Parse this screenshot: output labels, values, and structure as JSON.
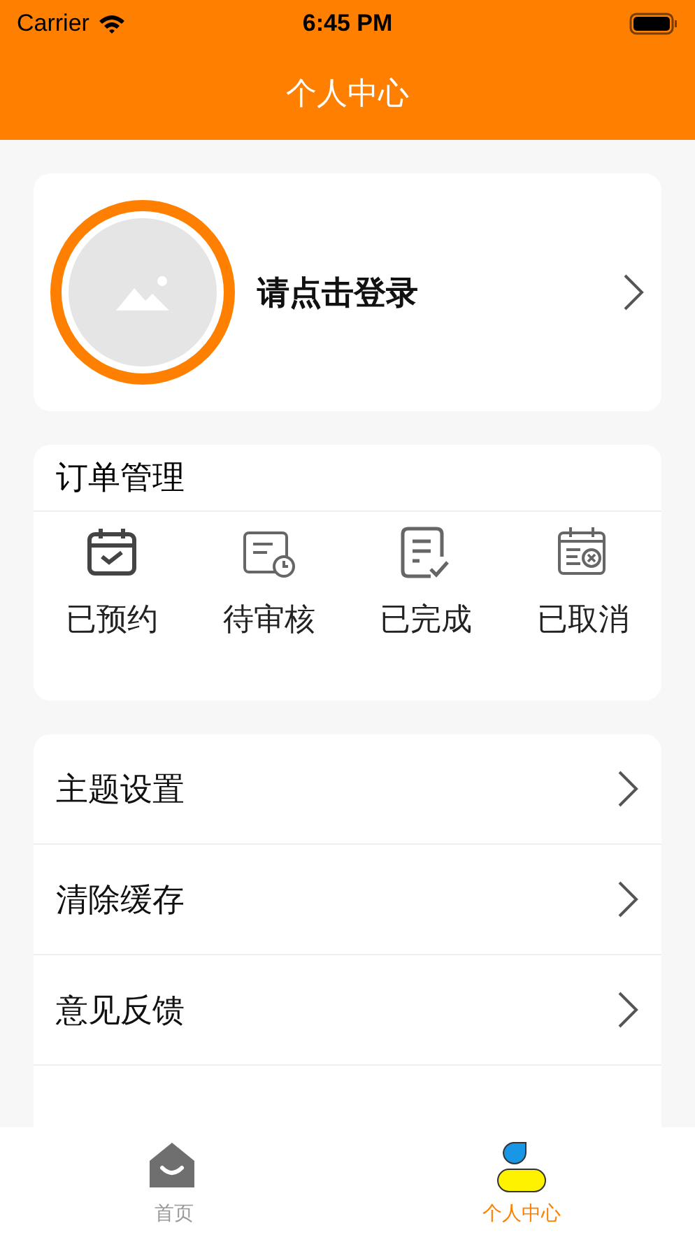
{
  "status_bar": {
    "carrier": "Carrier",
    "time": "6:45 PM"
  },
  "nav_bar": {
    "title": "个人中心"
  },
  "profile": {
    "login_prompt": "请点击登录"
  },
  "orders": {
    "title": "订单管理",
    "items": [
      {
        "kind": "booked",
        "label": "已预约"
      },
      {
        "kind": "pending",
        "label": "待审核"
      },
      {
        "kind": "done",
        "label": "已完成"
      },
      {
        "kind": "cancelled",
        "label": "已取消"
      }
    ]
  },
  "menu": [
    {
      "label": "主题设置"
    },
    {
      "label": "清除缓存"
    },
    {
      "label": "意见反馈"
    }
  ],
  "tab_bar": [
    {
      "kind": "home",
      "label": "首页",
      "selected": false
    },
    {
      "kind": "person",
      "label": "个人中心",
      "selected": true
    }
  ]
}
